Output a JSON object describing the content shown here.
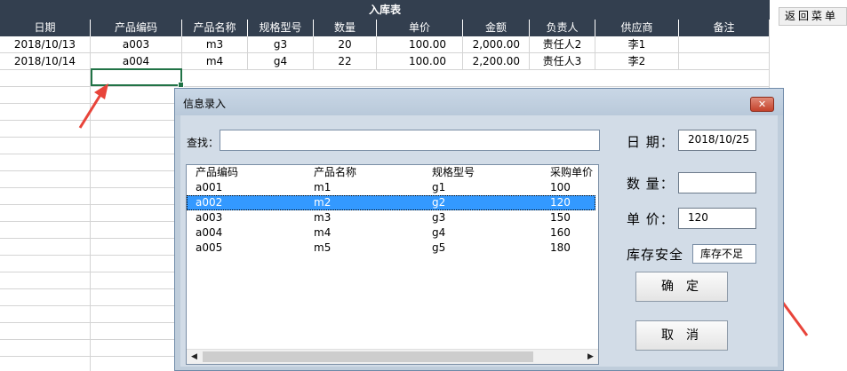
{
  "sheet": {
    "title": "入库表",
    "headers": [
      "日期",
      "产品编码",
      "产品名称",
      "规格型号",
      "数量",
      "单价",
      "金额",
      "负责人",
      "供应商",
      "备注"
    ],
    "rows": [
      [
        "2018/10/13",
        "a003",
        "m3",
        "g3",
        "20",
        "100.00",
        "2,000.00",
        "责任人2",
        "李1",
        ""
      ],
      [
        "2018/10/14",
        "a004",
        "m4",
        "g4",
        "22",
        "100.00",
        "2,200.00",
        "责任人3",
        "李2",
        ""
      ]
    ]
  },
  "return_button": "返回菜单",
  "dialog": {
    "title": "信息录入",
    "close_label": "✕",
    "search_label": "查找：",
    "search_value": "",
    "list_headers": [
      "产品编码",
      "产品名称",
      "规格型号",
      "采购单价"
    ],
    "list_rows": [
      [
        "a001",
        "m1",
        "g1",
        "100"
      ],
      [
        "a002",
        "m2",
        "g2",
        "120"
      ],
      [
        "a003",
        "m3",
        "g3",
        "150"
      ],
      [
        "a004",
        "m4",
        "g4",
        "160"
      ],
      [
        "a005",
        "m5",
        "g5",
        "180"
      ]
    ],
    "selected_row": 1,
    "date_label": "日 期：",
    "date_value": "2018/10/25",
    "qty_label": "数 量：",
    "qty_value": "",
    "price_label": "单 价：",
    "price_value": "120",
    "stock_label": "库存安全",
    "stock_value": "库存不足",
    "ok_label": "确定",
    "cancel_label": "取消",
    "scroll_left_icon": "◀",
    "scroll_right_icon": "▶"
  },
  "colors": {
    "header_bg": "#333f4f",
    "selection": "#3399ff",
    "annotation_arrow": "#e8443a",
    "cell_cursor": "#217346"
  }
}
